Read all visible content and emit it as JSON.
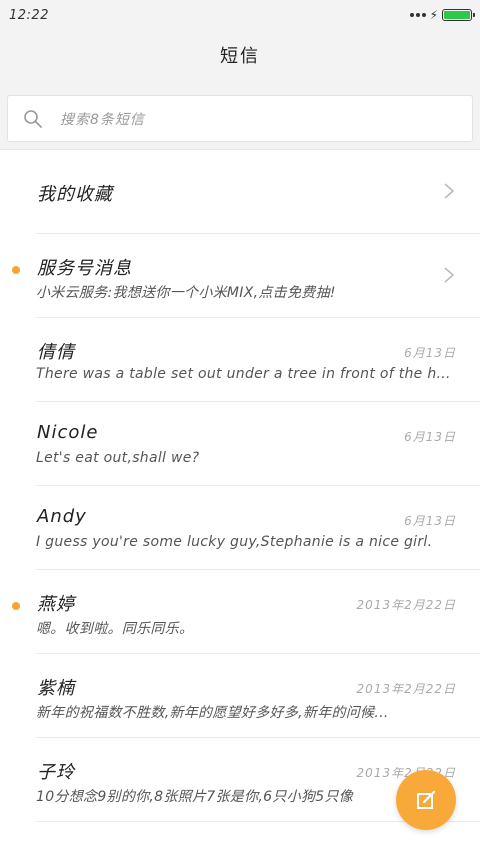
{
  "status_bar": {
    "time": "12:22"
  },
  "header": {
    "title": "短信"
  },
  "search": {
    "placeholder": "搜索8条短信"
  },
  "colors": {
    "accent": "#f8a93a",
    "unread_dot": "#f4a533",
    "battery": "#2fc84a"
  },
  "favorites": {
    "label": "我的收藏"
  },
  "conversations": [
    {
      "name": "服务号消息",
      "preview": "小米云服务:我想送你一个小米MIX,点击免费抽!",
      "date": "",
      "unread": true,
      "chevron": true
    },
    {
      "name": "倩倩",
      "preview": "There was a table set out under a tree in front of the hous",
      "date": "6月13日",
      "unread": false
    },
    {
      "name": "Nicole",
      "preview": "Let's eat out,shall we?",
      "date": "6月13日",
      "unread": false
    },
    {
      "name": "Andy",
      "preview": "I guess you're some lucky guy,Stephanie is a nice girl.",
      "date": "6月13日",
      "unread": false
    },
    {
      "name": "燕婷",
      "preview": "嗯。收到啦。同乐同乐。",
      "date": "2013年2月22日",
      "unread": true
    },
    {
      "name": "紫楠",
      "preview": "新年的祝福数不胜数,新年的愿望好多好多,新年的问候...",
      "date": "2013年2月22日",
      "unread": false
    },
    {
      "name": "子玲",
      "preview": "10分想念9别的你,8张照片7张是你,6只小狗5只像",
      "date": "2013年2月22日",
      "unread": false
    }
  ],
  "fab": {
    "icon": "compose-icon"
  }
}
